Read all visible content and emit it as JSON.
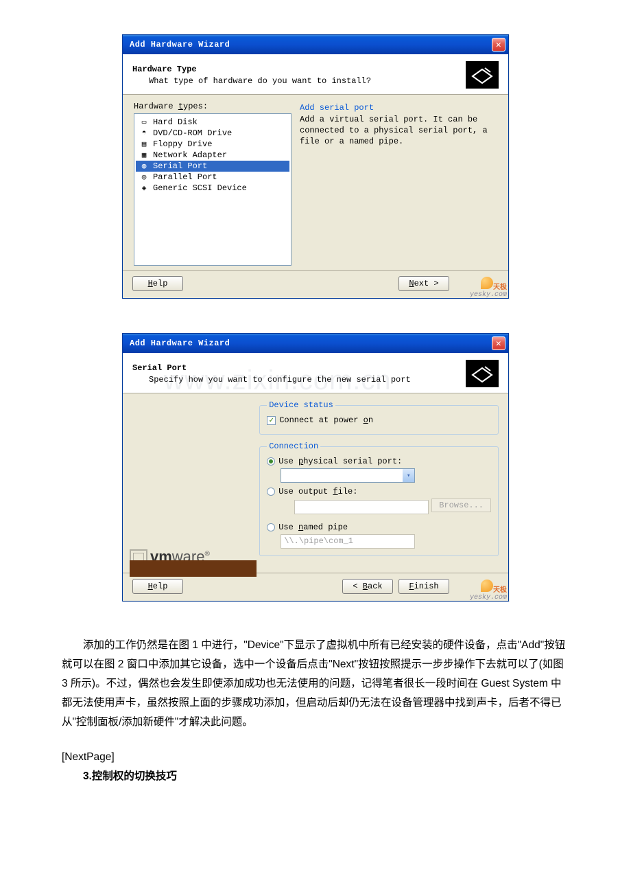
{
  "dialog1": {
    "title": "Add Hardware Wizard",
    "header_title": "Hardware Type",
    "header_sub": "What type of hardware do you want to install?",
    "list_label_pre": "Hardware ",
    "list_label_key": "t",
    "list_label_post": "ypes:",
    "items": [
      {
        "icon": "hdd-icon",
        "label": "Hard Disk",
        "selected": false
      },
      {
        "icon": "cd-icon",
        "label": "DVD/CD-ROM Drive",
        "selected": false
      },
      {
        "icon": "floppy-icon",
        "label": "Floppy Drive",
        "selected": false
      },
      {
        "icon": "network-icon",
        "label": "Network Adapter",
        "selected": false
      },
      {
        "icon": "serial-icon",
        "label": "Serial Port",
        "selected": true
      },
      {
        "icon": "parallel-icon",
        "label": "Parallel Port",
        "selected": false
      },
      {
        "icon": "scsi-icon",
        "label": "Generic SCSI Device",
        "selected": false
      }
    ],
    "desc_title": "Add serial port",
    "desc_text": "Add a virtual serial port. It can be connected to a physical serial port, a file or a named pipe.",
    "help_label": "Help",
    "next_label": "Next >",
    "watermark_brand": "天极",
    "watermark_url": "yesky.com"
  },
  "dialog2": {
    "title": "Add Hardware Wizard",
    "header_title": "Serial Port",
    "header_sub": "Specify how you want to configure the new serial port",
    "device_status_legend": "Device status",
    "connect_label": "Connect at power on",
    "connect_key": "o",
    "connection_legend": "Connection",
    "radio_phys_pre": "Use ",
    "radio_phys_key": "p",
    "radio_phys_post": "hysical serial port:",
    "radio_file_pre": "Use output ",
    "radio_file_key": "f",
    "radio_file_post": "ile:",
    "browse_label": "Browse...",
    "radio_pipe_pre": "Use ",
    "radio_pipe_key": "n",
    "radio_pipe_post": "amed pipe",
    "pipe_placeholder": "\\\\.\\pipe\\com_1",
    "vmware_bold": "vm",
    "vmware_rest": "ware",
    "help_label": "Help",
    "back_label": "< Back",
    "finish_label": "Finish",
    "watermark_brand": "天极",
    "watermark_url": "yesky.com",
    "faint_wm": "www.zixin.com.cn"
  },
  "paragraph": "添加的工作仍然是在图 1 中进行，\"Device\"下显示了虚拟机中所有已经安装的硬件设备，点击\"Add\"按钮就可以在图 2 窗口中添加其它设备，选中一个设备后点击\"Next\"按钮按照提示一步步操作下去就可以了(如图 3 所示)。不过，偶然也会发生即使添加成功也无法使用的问题，记得笔者很长一段时间在 Guest System 中都无法使用声卡，虽然按照上面的步骤成功添加，但启动后却仍无法在设备管理器中找到声卡，后者不得已从\"控制面板/添加新硬件\"才解决此问题。",
  "next_page": "[NextPage]",
  "section3": "3.控制权的切换技巧"
}
